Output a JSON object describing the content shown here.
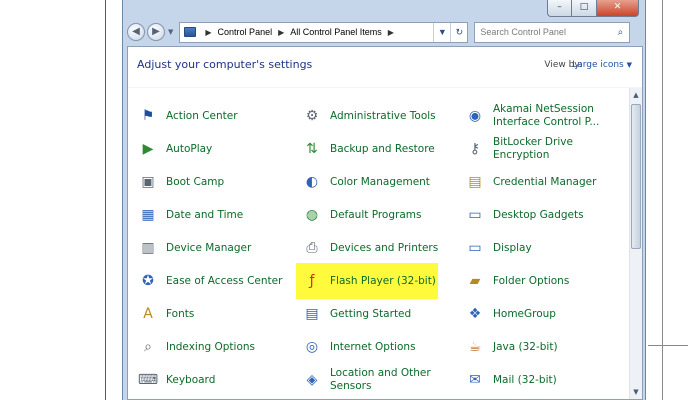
{
  "window": {
    "controls": {
      "minimize": "–",
      "maximize": "□",
      "close": "✕"
    }
  },
  "nav": {
    "back": "◀",
    "forward": "▶",
    "history_dropdown": "▼",
    "breadcrumb": [
      "Control Panel",
      "All Control Panel Items"
    ],
    "crumb_sep": "▶",
    "address_dropdown": "▼",
    "refresh": "↻"
  },
  "search": {
    "placeholder": "Search Control Panel"
  },
  "content": {
    "heading": "Adjust your computer's settings",
    "view_by_label": "View by:",
    "view_by_value": "Large icons",
    "view_by_dropdown": "▼"
  },
  "items": [
    {
      "id": "action-center",
      "label": "Action Center",
      "icon": "flag-icon",
      "glyph": "⚑"
    },
    {
      "id": "administrative-tools",
      "label": "Administrative Tools",
      "icon": "admin-tools-icon",
      "glyph": "⚙"
    },
    {
      "id": "akamai",
      "label": "Akamai NetSession Interface Control P...",
      "icon": "akamai-icon",
      "glyph": "◉"
    },
    {
      "id": "autoplay",
      "label": "AutoPlay",
      "icon": "autoplay-icon",
      "glyph": "▶"
    },
    {
      "id": "backup-restore",
      "label": "Backup and Restore",
      "icon": "backup-icon",
      "glyph": "⇅"
    },
    {
      "id": "bitlocker",
      "label": "BitLocker Drive Encryption",
      "icon": "key-icon",
      "glyph": "⚷"
    },
    {
      "id": "boot-camp",
      "label": "Boot Camp",
      "icon": "boot-camp-icon",
      "glyph": "▣"
    },
    {
      "id": "color-management",
      "label": "Color Management",
      "icon": "color-icon",
      "glyph": "◐"
    },
    {
      "id": "credential-manager",
      "label": "Credential Manager",
      "icon": "vault-icon",
      "glyph": "▤"
    },
    {
      "id": "date-time",
      "label": "Date and Time",
      "icon": "calendar-icon",
      "glyph": "▦"
    },
    {
      "id": "default-programs",
      "label": "Default Programs",
      "icon": "default-programs-icon",
      "glyph": "◍"
    },
    {
      "id": "desktop-gadgets",
      "label": "Desktop Gadgets",
      "icon": "gadgets-icon",
      "glyph": "▭"
    },
    {
      "id": "device-manager",
      "label": "Device Manager",
      "icon": "device-manager-icon",
      "glyph": "▥"
    },
    {
      "id": "devices-printers",
      "label": "Devices and Printers",
      "icon": "printer-icon",
      "glyph": "⎙"
    },
    {
      "id": "display",
      "label": "Display",
      "icon": "display-icon",
      "glyph": "▭"
    },
    {
      "id": "ease-of-access",
      "label": "Ease of Access Center",
      "icon": "ease-of-access-icon",
      "glyph": "✪"
    },
    {
      "id": "flash-player",
      "label": "Flash Player (32-bit)",
      "icon": "flash-icon",
      "glyph": "ƒ"
    },
    {
      "id": "folder-options",
      "label": "Folder Options",
      "icon": "folder-icon",
      "glyph": "▰"
    },
    {
      "id": "fonts",
      "label": "Fonts",
      "icon": "fonts-icon",
      "glyph": "A"
    },
    {
      "id": "getting-started",
      "label": "Getting Started",
      "icon": "getting-started-icon",
      "glyph": "▤"
    },
    {
      "id": "homegroup",
      "label": "HomeGroup",
      "icon": "homegroup-icon",
      "glyph": "❖"
    },
    {
      "id": "indexing-options",
      "label": "Indexing Options",
      "icon": "indexing-icon",
      "glyph": "⌕"
    },
    {
      "id": "internet-options",
      "label": "Internet Options",
      "icon": "globe-icon",
      "glyph": "◎"
    },
    {
      "id": "java",
      "label": "Java (32-bit)",
      "icon": "java-icon",
      "glyph": "☕"
    },
    {
      "id": "keyboard",
      "label": "Keyboard",
      "icon": "keyboard-icon",
      "glyph": "⌨"
    },
    {
      "id": "location-sensors",
      "label": "Location and Other Sensors",
      "icon": "location-icon",
      "glyph": "◈"
    },
    {
      "id": "mail",
      "label": "Mail (32-bit)",
      "icon": "mail-icon",
      "glyph": "✉"
    }
  ],
  "colors": {
    "link_green": "#0b6a2a",
    "heading_blue": "#1e3287",
    "highlight": "#fffb3c",
    "window_frame": "#c5d6ea"
  }
}
